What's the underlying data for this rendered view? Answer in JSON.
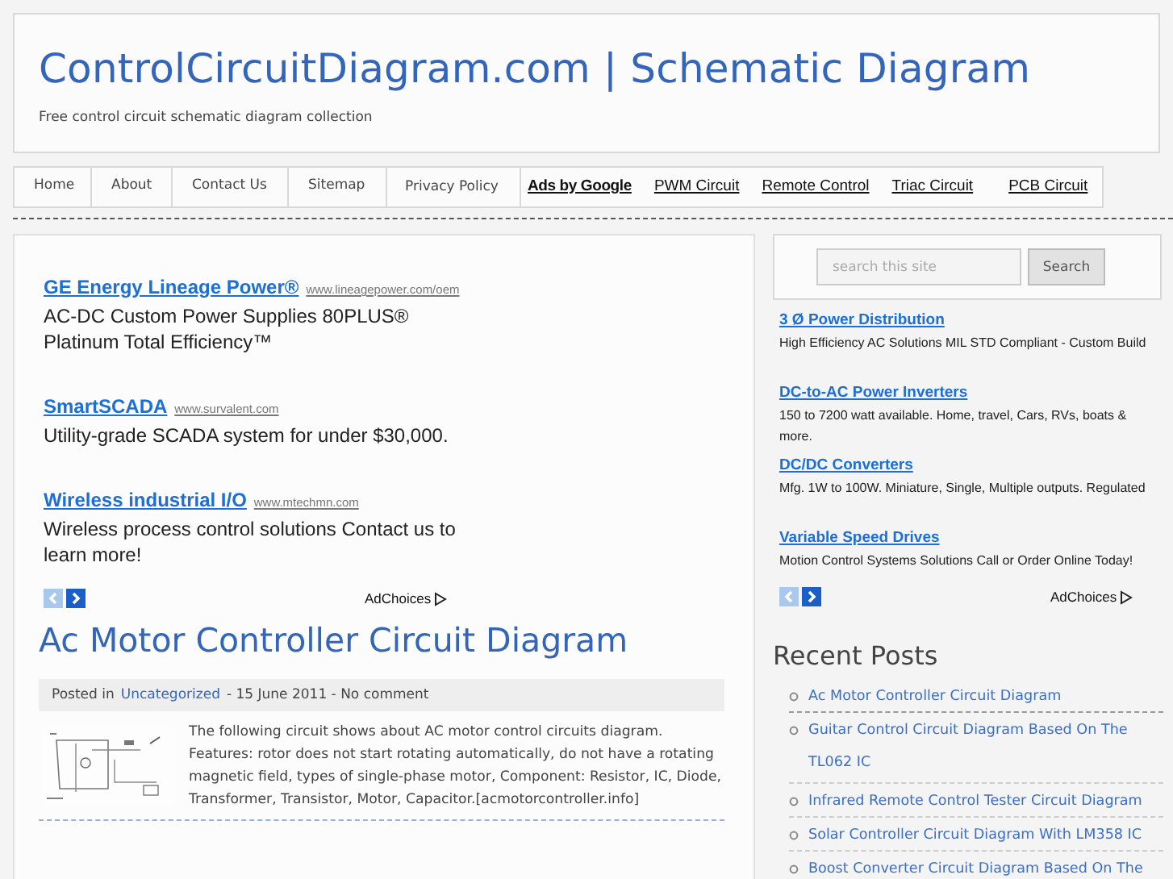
{
  "header": {
    "title": "ControlCircuitDiagram.com | Schematic Diagram",
    "tagline": "Free control circuit schematic diagram collection"
  },
  "nav": {
    "pages": [
      {
        "label": "Home"
      },
      {
        "label": "About"
      },
      {
        "label": "Contact Us"
      },
      {
        "label": "Sitemap"
      },
      {
        "label": "Privacy Policy"
      }
    ],
    "ads_label": "Ads by Google",
    "ad_links": [
      {
        "label": "PWM Circuit"
      },
      {
        "label": "Remote Control"
      },
      {
        "label": "Triac Circuit"
      },
      {
        "label": "PCB Circuit"
      }
    ]
  },
  "main_ads": {
    "items": [
      {
        "title": "GE Energy Lineage Power®",
        "url": "www.lineagepower.com/oem",
        "text": "AC-DC Custom Power Supplies 80PLUS® Platinum Total Efficiency™"
      },
      {
        "title": "SmartSCADA",
        "url": "www.survalent.com",
        "text": "Utility-grade SCADA system for under $30,000."
      },
      {
        "title": "Wireless industrial I/O",
        "url": "www.mtechmn.com",
        "text": "Wireless process control solutions Contact us to learn more!"
      }
    ],
    "adchoices": "AdChoices"
  },
  "post": {
    "title": "Ac Motor Controller Circuit Diagram",
    "meta_prefix": "Posted in",
    "category": "Uncategorized",
    "meta_suffix": "- 15 June 2011 - No comment",
    "excerpt": "The following circuit shows about AC motor control circuits diagram. Features: rotor does not start rotating automatically, do not have a rotating magnetic field, types of single-phase motor, Component: Resistor, IC, Diode, Transformer, Transistor, Motor, Capacitor.[acmotorcontroller.info]"
  },
  "search": {
    "placeholder": "search this site",
    "button": "Search"
  },
  "side_ads": {
    "items": [
      {
        "title": "3 Ø Power Distribution",
        "text": "High Efficiency AC Solutions MIL STD Compliant - Custom Build"
      },
      {
        "title": "DC-to-AC Power Inverters",
        "text": "150 to 7200 watt available. Home, travel, Cars, RVs, boats & more."
      },
      {
        "title": "DC/DC Converters",
        "text": "Mfg. 1W to 100W. Miniature, Single, Multiple outputs. Regulated"
      },
      {
        "title": "Variable Speed Drives",
        "text": "Motion Control Systems Solutions Call or Order Online Today!"
      }
    ],
    "adchoices": "AdChoices"
  },
  "recent_posts": {
    "heading": "Recent Posts",
    "items": [
      {
        "label": "Ac Motor Controller Circuit Diagram"
      },
      {
        "label": "Guitar Control Circuit Diagram Based On The TL062 IC"
      },
      {
        "label": "Infrared Remote Control Tester Circuit Diagram"
      },
      {
        "label": "Solar Controller Circuit Diagram With LM358 IC"
      },
      {
        "label": "Boost Converter Circuit Diagram Based On The"
      }
    ]
  }
}
